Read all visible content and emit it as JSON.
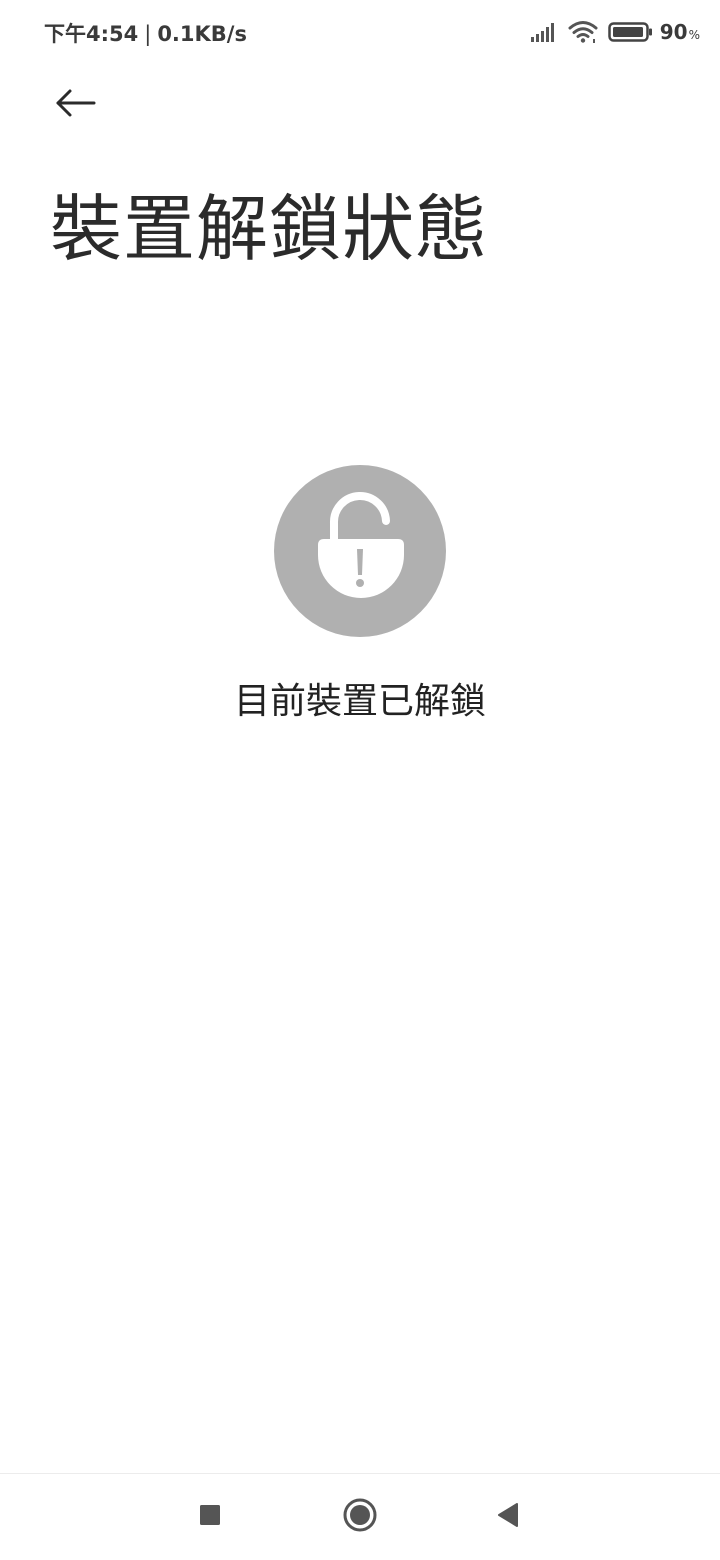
{
  "status_bar": {
    "time": "下午4:54",
    "separator": "|",
    "network_speed": "0.1KB/s",
    "battery_level": "90",
    "battery_unit": "%",
    "icons": [
      "signal-icon",
      "wifi-icon",
      "battery-icon"
    ]
  },
  "header": {
    "back_icon": "arrow-left-icon",
    "title": "裝置解鎖狀態"
  },
  "main": {
    "lock_icon": "unlocked-padlock-icon",
    "message": "目前裝置已解鎖"
  },
  "nav_bar": {
    "icons": [
      "recents-square-icon",
      "home-circle-icon",
      "back-triangle-icon"
    ]
  },
  "colors": {
    "background": "#ffffff",
    "text": "#222222",
    "icon_circle": "#b0b0b0",
    "nav_icon": "#555555"
  }
}
